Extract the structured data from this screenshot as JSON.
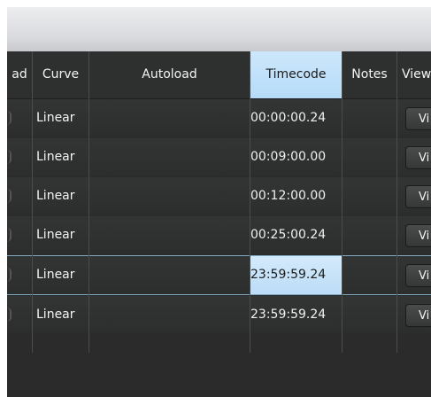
{
  "headers": {
    "load": "ad",
    "curve": "Curve",
    "autoload": "Autoload",
    "timecode": "Timecode",
    "notes": "Notes",
    "view": "View"
  },
  "rows": [
    {
      "curve": "Linear",
      "autoload": "",
      "timecode": "00:00:00.24",
      "notes": "",
      "view": "Vi"
    },
    {
      "curve": "Linear",
      "autoload": "",
      "timecode": "00:09:00.00",
      "notes": "",
      "view": "Vi"
    },
    {
      "curve": "Linear",
      "autoload": "",
      "timecode": "00:12:00.00",
      "notes": "",
      "view": "Vi"
    },
    {
      "curve": "Linear",
      "autoload": "",
      "timecode": "00:25:00.24",
      "notes": "",
      "view": "Vi"
    },
    {
      "curve": "Linear",
      "autoload": "",
      "timecode": "23:59:59.24",
      "notes": "",
      "view": "Vi"
    },
    {
      "curve": "Linear",
      "autoload": "",
      "timecode": "23:59:59.24",
      "notes": "",
      "view": "Vi"
    }
  ],
  "colors": {
    "background": "#2b2b2b",
    "highlight": "#bcdcf7",
    "text": "#f4f4f4"
  }
}
